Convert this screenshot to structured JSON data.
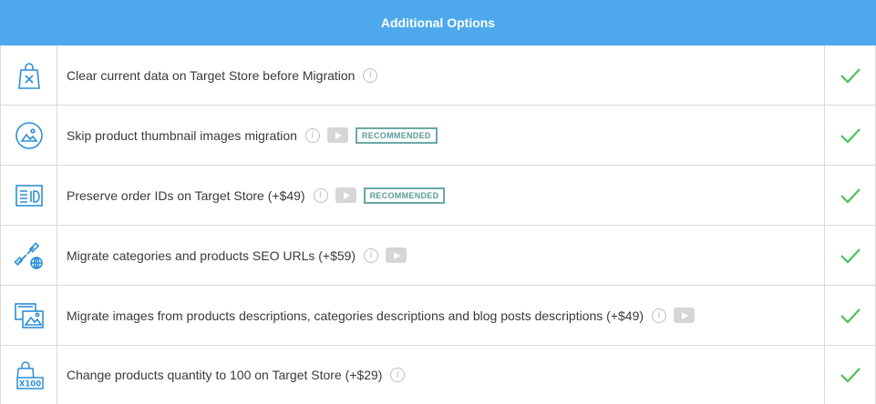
{
  "header": {
    "title": "Additional Options"
  },
  "colors": {
    "header_bg": "#4ea9ec",
    "icon": "#2d8fd5",
    "check": "#4cc15b",
    "badge": "#5b9a9a"
  },
  "options": [
    {
      "icon": "bag-x-icon",
      "label": "Clear current data on Target Store before Migration",
      "has_info": true,
      "has_video": false,
      "badge": "",
      "checked": true
    },
    {
      "icon": "image-circle-icon",
      "label": "Skip product thumbnail images migration",
      "has_info": true,
      "has_video": true,
      "badge": "RECOMMENDED",
      "checked": true
    },
    {
      "icon": "id-card-icon",
      "label": "Preserve order IDs on Target Store (+$49)",
      "has_info": true,
      "has_video": true,
      "badge": "RECOMMENDED",
      "checked": true
    },
    {
      "icon": "seo-link-globe-icon",
      "label": "Migrate categories and products SEO URLs (+$59)",
      "has_info": true,
      "has_video": true,
      "badge": "",
      "checked": true
    },
    {
      "icon": "images-stack-icon",
      "label": "Migrate images from products descriptions, categories descriptions and blog posts descriptions (+$49)",
      "has_info": true,
      "has_video": true,
      "badge": "",
      "checked": true
    },
    {
      "icon": "bag-x100-icon",
      "label": "Change products quantity to 100 on Target Store (+$29)",
      "has_info": true,
      "has_video": false,
      "badge": "",
      "checked": true
    }
  ]
}
